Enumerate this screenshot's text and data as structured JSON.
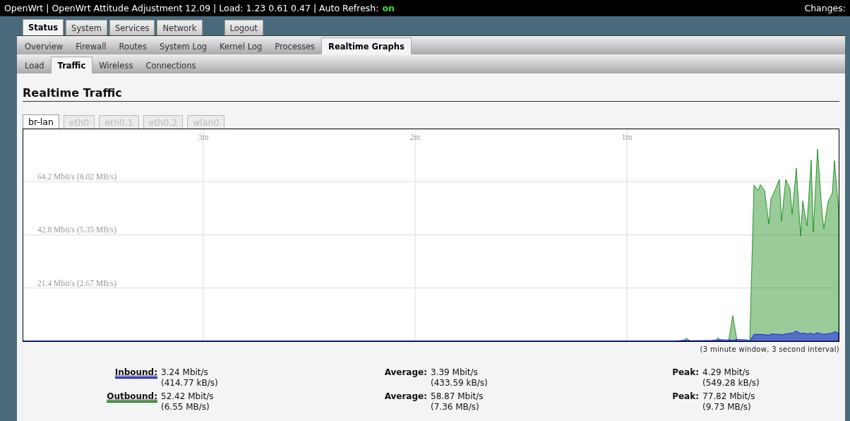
{
  "header": {
    "status_text": "OpenWrt | OpenWrt Attitude Adjustment 12.09 | Load: 1.23 0.61 0.47 | Auto Refresh:",
    "auto_refresh": "on",
    "changes": "Changes:"
  },
  "main_tabs": [
    {
      "label": "Status",
      "selected": true,
      "kind": "page"
    },
    {
      "label": "System",
      "selected": false,
      "kind": "page"
    },
    {
      "label": "Services",
      "selected": false,
      "kind": "page"
    },
    {
      "label": "Network",
      "selected": false,
      "kind": "page"
    },
    {
      "label": "Logout",
      "selected": false,
      "kind": "action"
    }
  ],
  "sub_tabs": [
    {
      "label": "Overview",
      "selected": false
    },
    {
      "label": "Firewall",
      "selected": false
    },
    {
      "label": "Routes",
      "selected": false
    },
    {
      "label": "System Log",
      "selected": false
    },
    {
      "label": "Kernel Log",
      "selected": false
    },
    {
      "label": "Processes",
      "selected": false
    },
    {
      "label": "Realtime Graphs",
      "selected": true
    }
  ],
  "graph_tabs": [
    {
      "label": "Load",
      "selected": false
    },
    {
      "label": "Traffic",
      "selected": true
    },
    {
      "label": "Wireless",
      "selected": false
    },
    {
      "label": "Connections",
      "selected": false
    }
  ],
  "title": "Realtime Traffic",
  "interface_tabs": [
    {
      "label": "br-lan",
      "selected": true
    },
    {
      "label": "eth0",
      "selected": false
    },
    {
      "label": "eth0.1",
      "selected": false
    },
    {
      "label": "eth0.2",
      "selected": false
    },
    {
      "label": "wlan0",
      "selected": false
    }
  ],
  "chart_data": {
    "type": "area",
    "grid": true,
    "xlim": [
      3.85,
      0
    ],
    "ylim": [
      0,
      85.3
    ],
    "xticks": [
      {
        "value": 3,
        "label": "3m"
      },
      {
        "value": 2,
        "label": "2m"
      },
      {
        "value": 1,
        "label": "1m"
      }
    ],
    "yticks": [
      {
        "value": 21.4,
        "label": "21.4 Mbit/s"
      },
      {
        "value": 42.8,
        "label": "42.8 Mbit/s"
      },
      {
        "value": 64.2,
        "label": "64.2 Mbit/s"
      }
    ],
    "x": [
      3.85,
      0.78,
      0.73,
      0.72,
      0.7,
      0.6,
      0.58,
      0.57,
      0.55,
      0.52,
      0.5,
      0.48,
      0.43,
      0.42,
      0.4,
      0.38,
      0.37,
      0.35,
      0.33,
      0.32,
      0.3,
      0.28,
      0.27,
      0.25,
      0.23,
      0.22,
      0.2,
      0.18,
      0.17,
      0.15,
      0.13,
      0.12,
      0.1,
      0.08,
      0.07,
      0.05,
      0.03,
      0.02,
      0
    ],
    "series": [
      {
        "color": "#008000",
        "values": [
          0,
          0,
          0,
          1.2,
          0,
          0,
          0,
          1.4,
          0,
          0,
          10.3,
          0,
          0,
          0,
          62.9,
          60.7,
          63.0,
          60.7,
          47.2,
          57.2,
          61.0,
          65.1,
          48.4,
          65.1,
          61.4,
          51.0,
          69.6,
          42.4,
          56.5,
          46.4,
          73.0,
          43.9,
          77.3,
          52.9,
          45.3,
          56.2,
          59.7,
          72.7,
          52.4
        ]
      },
      {
        "color": "#0000ff",
        "values": [
          0,
          0,
          0.4,
          0.3,
          0.2,
          0.3,
          0.5,
          0.4,
          0.6,
          0.5,
          0.3,
          0.7,
          0.5,
          0,
          2.8,
          2.7,
          2.8,
          2.6,
          2.4,
          2.9,
          2.8,
          2.8,
          2.5,
          2.9,
          3.2,
          3.1,
          4.1,
          3.0,
          3.3,
          2.9,
          3.2,
          2.7,
          3.4,
          2.9,
          2.8,
          3.0,
          3.2,
          3.9,
          3.2
        ]
      }
    ]
  },
  "y_byte_rates": [
    "(8.02 MB/s)",
    "(5.35 MB/s)",
    "(2.67 MB/s)"
  ],
  "note": "(3 minute window, 3 second interval)",
  "stats": [
    {
      "label": "Inbound:",
      "color": "#0000ff",
      "current": [
        "3.24 Mbit/s",
        "(414.77 kB/s)"
      ],
      "average_label": "Average:",
      "average": [
        "3.39 Mbit/s",
        "(433.59 kB/s)"
      ],
      "peak_label": "Peak:",
      "peak": [
        "4.29 Mbit/s",
        "(549.28 kB/s)"
      ]
    },
    {
      "label": "Outbound:",
      "color": "#008000",
      "current": [
        "52.42 Mbit/s",
        "(6.55 MB/s)"
      ],
      "average_label": "Average:",
      "average": [
        "58.87 Mbit/s",
        "(7.36 MB/s)"
      ],
      "peak_label": "Peak:",
      "peak": [
        "77.82 Mbit/s",
        "(9.73 MB/s)"
      ]
    }
  ]
}
